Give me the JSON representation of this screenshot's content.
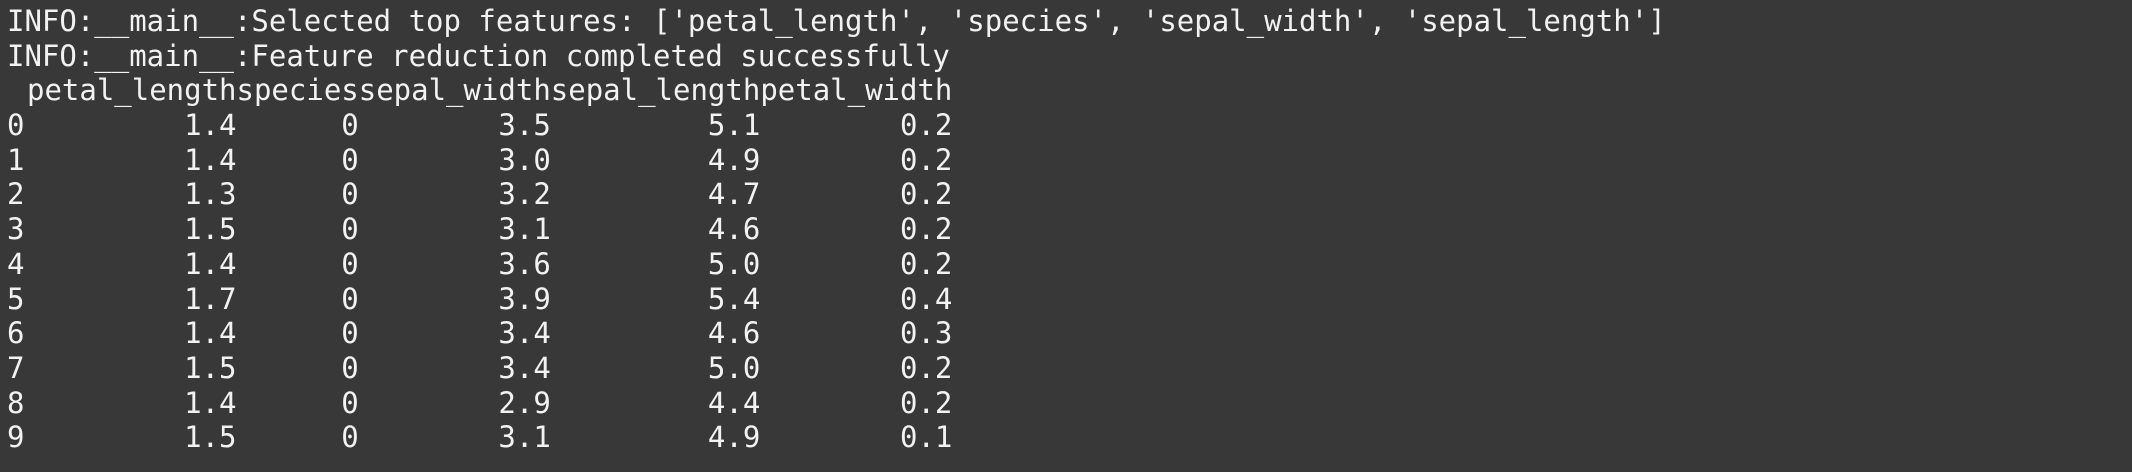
{
  "log_lines": [
    "INFO:__main__:Selected top features: ['petal_length', 'species', 'sepal_width', 'sepal_length']",
    "INFO:__main__:Feature reduction completed successfully"
  ],
  "table": {
    "columns": [
      "petal_length",
      "species",
      "sepal_width",
      "sepal_length",
      "petal_width"
    ],
    "rows": [
      {
        "index": "0",
        "values": [
          "1.4",
          "0",
          "3.5",
          "5.1",
          "0.2"
        ]
      },
      {
        "index": "1",
        "values": [
          "1.4",
          "0",
          "3.0",
          "4.9",
          "0.2"
        ]
      },
      {
        "index": "2",
        "values": [
          "1.3",
          "0",
          "3.2",
          "4.7",
          "0.2"
        ]
      },
      {
        "index": "3",
        "values": [
          "1.5",
          "0",
          "3.1",
          "4.6",
          "0.2"
        ]
      },
      {
        "index": "4",
        "values": [
          "1.4",
          "0",
          "3.6",
          "5.0",
          "0.2"
        ]
      },
      {
        "index": "5",
        "values": [
          "1.7",
          "0",
          "3.9",
          "5.4",
          "0.4"
        ]
      },
      {
        "index": "6",
        "values": [
          "1.4",
          "0",
          "3.4",
          "4.6",
          "0.3"
        ]
      },
      {
        "index": "7",
        "values": [
          "1.5",
          "0",
          "3.4",
          "5.0",
          "0.2"
        ]
      },
      {
        "index": "8",
        "values": [
          "1.4",
          "0",
          "2.9",
          "4.4",
          "0.2"
        ]
      },
      {
        "index": "9",
        "values": [
          "1.5",
          "0",
          "3.1",
          "4.9",
          "0.1"
        ]
      }
    ]
  },
  "colors": {
    "background": "#383838",
    "foreground": "#f2f2f2"
  }
}
